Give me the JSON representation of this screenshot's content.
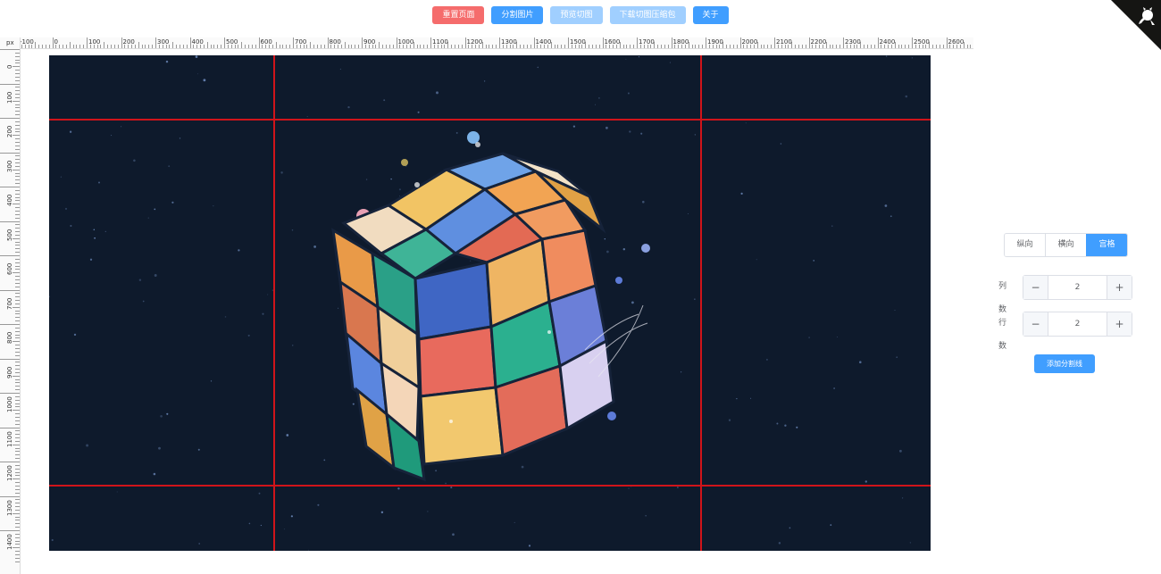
{
  "toolbar": {
    "reset_label": "重置页面",
    "split_label": "分割图片",
    "preview_label": "预览切图",
    "download_label": "下载切图压缩包",
    "about_label": "关于"
  },
  "ruler": {
    "unit": "px",
    "h_labels": [
      "-100",
      "0",
      "100",
      "200",
      "300",
      "400",
      "500",
      "600",
      "700",
      "800",
      "900",
      "1000",
      "1100",
      "1200",
      "1300",
      "1400",
      "1500",
      "1600",
      "1700",
      "1800",
      "1900",
      "2000",
      "2100",
      "2200",
      "2300",
      "2400",
      "2500",
      "2600"
    ],
    "v_labels": [
      "0",
      "100",
      "200",
      "300",
      "400",
      "500",
      "600",
      "700",
      "800",
      "900",
      "1000",
      "1100",
      "1200",
      "1300",
      "1400"
    ]
  },
  "panel": {
    "modes": [
      "纵向",
      "横向",
      "宫格"
    ],
    "active_mode": "宫格",
    "columns_label": "列数",
    "columns_value": "2",
    "rows_label": "行数",
    "rows_value": "2",
    "minus_symbol": "−",
    "plus_symbol": "+",
    "add_line_label": "添加分割线"
  },
  "colors": {
    "accent": "#409eff",
    "danger": "#f56c6c",
    "disabled": "#a0cfff",
    "cut_line": "#d0141a",
    "canvas_bg": "#0e1a2c"
  }
}
